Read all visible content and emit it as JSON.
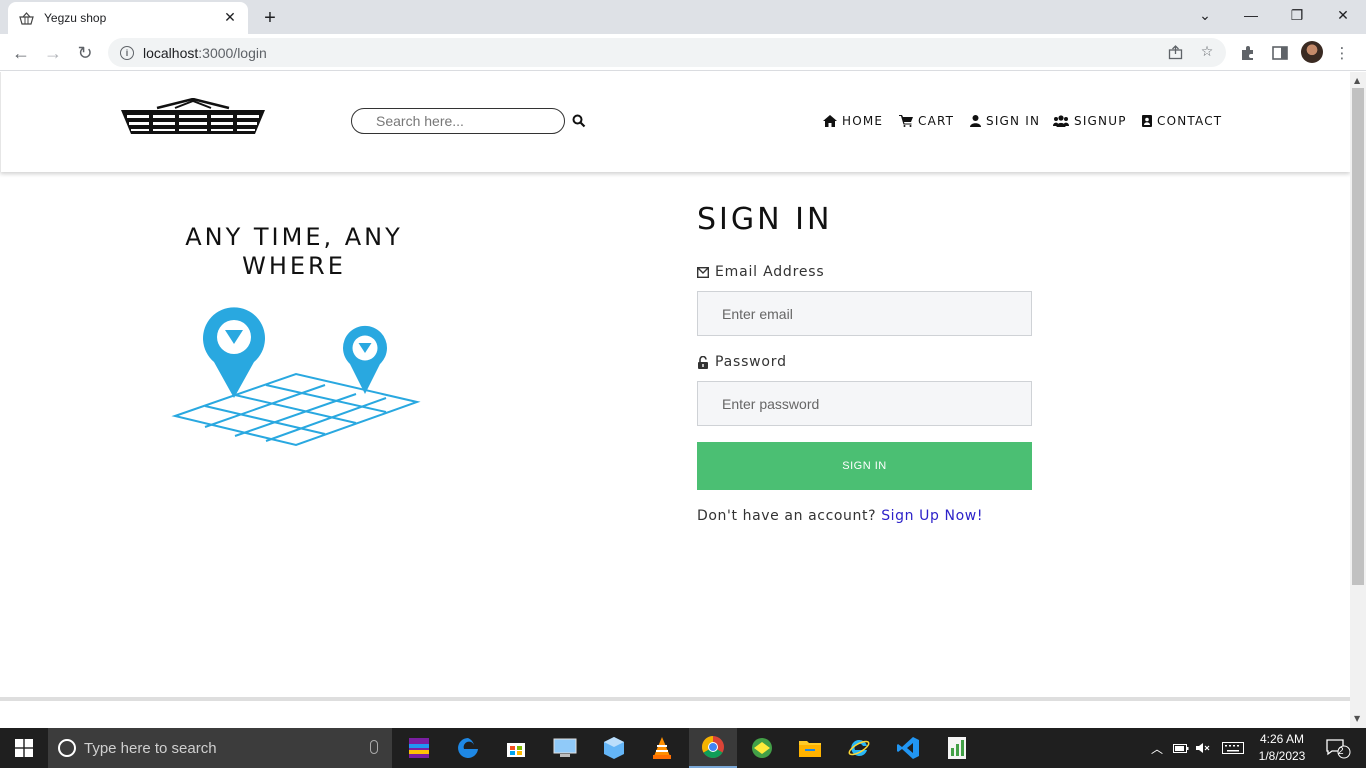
{
  "browser": {
    "tab_title": "Yegzu shop",
    "tab_close": "✕",
    "new_tab": "+",
    "url_host": "localhost",
    "url_path": ":3000/login",
    "win_minimize": "—",
    "win_restore": "❐",
    "win_close": "✕",
    "tab_list": "⌄"
  },
  "header": {
    "search_placeholder": "Search here...",
    "nav": {
      "home": "HOME",
      "cart": "CART",
      "sign_in": "SIGN IN",
      "signup": "SIGNUP",
      "contact": "CONTACT"
    }
  },
  "hero": {
    "title": "ANY TIME, ANY WHERE"
  },
  "form": {
    "title": "SIGN IN",
    "email_label": "Email Address",
    "email_placeholder": "Enter email",
    "password_label": "Password",
    "password_placeholder": "Enter password",
    "submit_label": "SIGN IN",
    "no_account_text": "Don't have an account?",
    "signup_link": "Sign Up Now!"
  },
  "colors": {
    "accent_green": "#4bbf73",
    "link_blue": "#2d22c9",
    "map_blue": "#29a8e0"
  },
  "taskbar": {
    "search_placeholder": "Type here to search",
    "time": "4:26 AM",
    "date": "1/8/2023",
    "notifications": "2"
  }
}
